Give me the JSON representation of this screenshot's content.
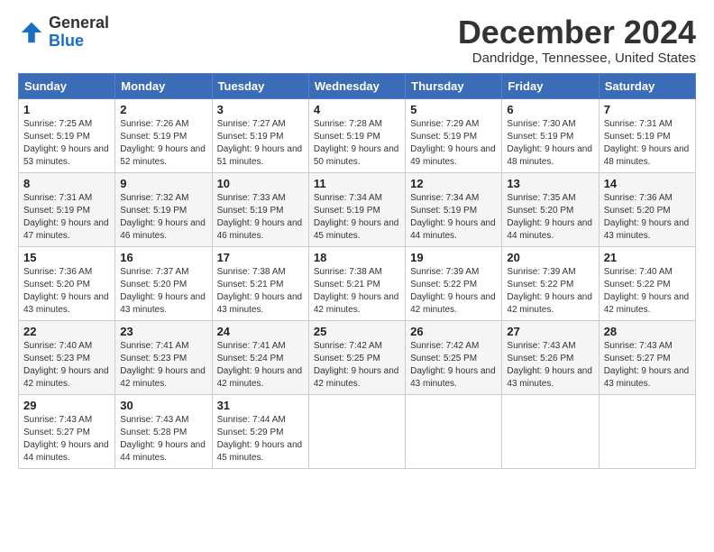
{
  "logo": {
    "line1": "General",
    "line2": "Blue"
  },
  "title": "December 2024",
  "location": "Dandridge, Tennessee, United States",
  "days_of_week": [
    "Sunday",
    "Monday",
    "Tuesday",
    "Wednesday",
    "Thursday",
    "Friday",
    "Saturday"
  ],
  "weeks": [
    [
      {
        "day": "1",
        "sunrise": "7:25 AM",
        "sunset": "5:19 PM",
        "daylight": "9 hours and 53 minutes."
      },
      {
        "day": "2",
        "sunrise": "7:26 AM",
        "sunset": "5:19 PM",
        "daylight": "9 hours and 52 minutes."
      },
      {
        "day": "3",
        "sunrise": "7:27 AM",
        "sunset": "5:19 PM",
        "daylight": "9 hours and 51 minutes."
      },
      {
        "day": "4",
        "sunrise": "7:28 AM",
        "sunset": "5:19 PM",
        "daylight": "9 hours and 50 minutes."
      },
      {
        "day": "5",
        "sunrise": "7:29 AM",
        "sunset": "5:19 PM",
        "daylight": "9 hours and 49 minutes."
      },
      {
        "day": "6",
        "sunrise": "7:30 AM",
        "sunset": "5:19 PM",
        "daylight": "9 hours and 48 minutes."
      },
      {
        "day": "7",
        "sunrise": "7:31 AM",
        "sunset": "5:19 PM",
        "daylight": "9 hours and 48 minutes."
      }
    ],
    [
      {
        "day": "8",
        "sunrise": "7:31 AM",
        "sunset": "5:19 PM",
        "daylight": "9 hours and 47 minutes."
      },
      {
        "day": "9",
        "sunrise": "7:32 AM",
        "sunset": "5:19 PM",
        "daylight": "9 hours and 46 minutes."
      },
      {
        "day": "10",
        "sunrise": "7:33 AM",
        "sunset": "5:19 PM",
        "daylight": "9 hours and 46 minutes."
      },
      {
        "day": "11",
        "sunrise": "7:34 AM",
        "sunset": "5:19 PM",
        "daylight": "9 hours and 45 minutes."
      },
      {
        "day": "12",
        "sunrise": "7:34 AM",
        "sunset": "5:19 PM",
        "daylight": "9 hours and 44 minutes."
      },
      {
        "day": "13",
        "sunrise": "7:35 AM",
        "sunset": "5:20 PM",
        "daylight": "9 hours and 44 minutes."
      },
      {
        "day": "14",
        "sunrise": "7:36 AM",
        "sunset": "5:20 PM",
        "daylight": "9 hours and 43 minutes."
      }
    ],
    [
      {
        "day": "15",
        "sunrise": "7:36 AM",
        "sunset": "5:20 PM",
        "daylight": "9 hours and 43 minutes."
      },
      {
        "day": "16",
        "sunrise": "7:37 AM",
        "sunset": "5:20 PM",
        "daylight": "9 hours and 43 minutes."
      },
      {
        "day": "17",
        "sunrise": "7:38 AM",
        "sunset": "5:21 PM",
        "daylight": "9 hours and 43 minutes."
      },
      {
        "day": "18",
        "sunrise": "7:38 AM",
        "sunset": "5:21 PM",
        "daylight": "9 hours and 42 minutes."
      },
      {
        "day": "19",
        "sunrise": "7:39 AM",
        "sunset": "5:22 PM",
        "daylight": "9 hours and 42 minutes."
      },
      {
        "day": "20",
        "sunrise": "7:39 AM",
        "sunset": "5:22 PM",
        "daylight": "9 hours and 42 minutes."
      },
      {
        "day": "21",
        "sunrise": "7:40 AM",
        "sunset": "5:22 PM",
        "daylight": "9 hours and 42 minutes."
      }
    ],
    [
      {
        "day": "22",
        "sunrise": "7:40 AM",
        "sunset": "5:23 PM",
        "daylight": "9 hours and 42 minutes."
      },
      {
        "day": "23",
        "sunrise": "7:41 AM",
        "sunset": "5:23 PM",
        "daylight": "9 hours and 42 minutes."
      },
      {
        "day": "24",
        "sunrise": "7:41 AM",
        "sunset": "5:24 PM",
        "daylight": "9 hours and 42 minutes."
      },
      {
        "day": "25",
        "sunrise": "7:42 AM",
        "sunset": "5:25 PM",
        "daylight": "9 hours and 42 minutes."
      },
      {
        "day": "26",
        "sunrise": "7:42 AM",
        "sunset": "5:25 PM",
        "daylight": "9 hours and 43 minutes."
      },
      {
        "day": "27",
        "sunrise": "7:43 AM",
        "sunset": "5:26 PM",
        "daylight": "9 hours and 43 minutes."
      },
      {
        "day": "28",
        "sunrise": "7:43 AM",
        "sunset": "5:27 PM",
        "daylight": "9 hours and 43 minutes."
      }
    ],
    [
      {
        "day": "29",
        "sunrise": "7:43 AM",
        "sunset": "5:27 PM",
        "daylight": "9 hours and 44 minutes."
      },
      {
        "day": "30",
        "sunrise": "7:43 AM",
        "sunset": "5:28 PM",
        "daylight": "9 hours and 44 minutes."
      },
      {
        "day": "31",
        "sunrise": "7:44 AM",
        "sunset": "5:29 PM",
        "daylight": "9 hours and 45 minutes."
      },
      null,
      null,
      null,
      null
    ]
  ]
}
